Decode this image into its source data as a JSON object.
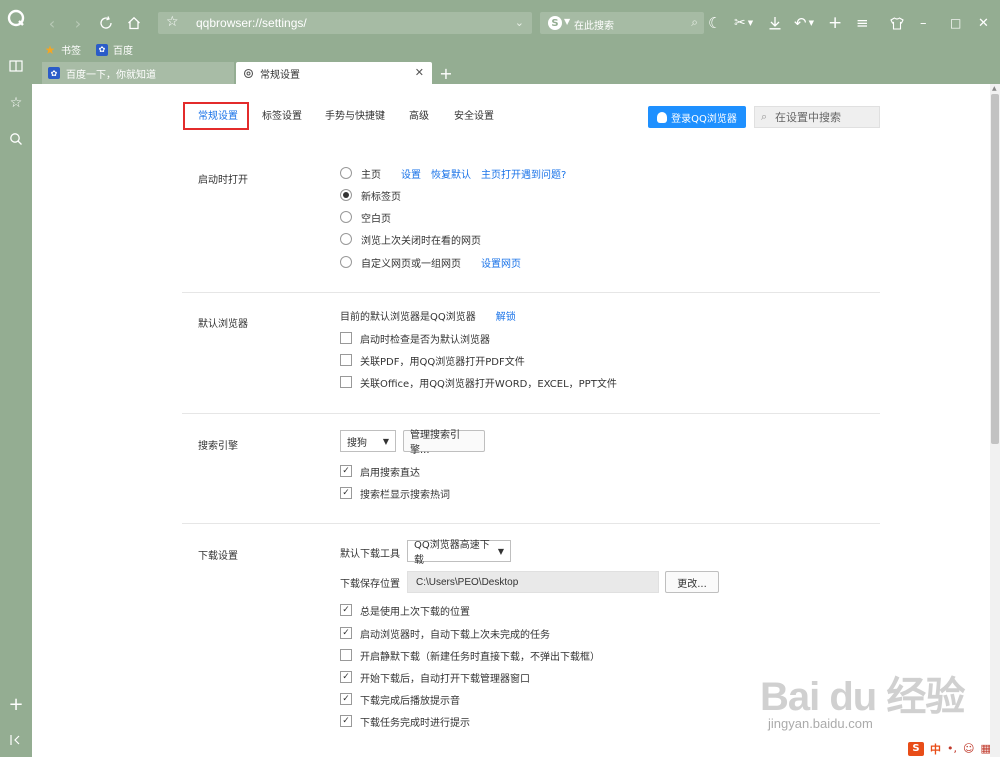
{
  "browser": {
    "address": "qqbrowser://settings/",
    "search_placeholder": "在此搜索",
    "search_engine_letter": "S"
  },
  "bookmarks": [
    {
      "label": "书签"
    },
    {
      "label": "百度"
    }
  ],
  "tabs": [
    {
      "title": "百度一下，你就知道",
      "active": false
    },
    {
      "title": "常规设置",
      "active": true
    }
  ],
  "settings": {
    "tabs": [
      {
        "label": "常规设置",
        "active": true
      },
      {
        "label": "标签设置",
        "active": false
      },
      {
        "label": "手势与快捷键",
        "active": false
      },
      {
        "label": "高级",
        "active": false
      },
      {
        "label": "安全设置",
        "active": false
      }
    ],
    "login_label": "登录QQ浏览器",
    "search_placeholder": "在设置中搜索",
    "startup": {
      "label": "启动时打开",
      "options": [
        {
          "label": "主页",
          "checked": false
        },
        {
          "label": "新标签页",
          "checked": true
        },
        {
          "label": "空白页",
          "checked": false
        },
        {
          "label": "浏览上次关闭时在看的网页",
          "checked": false
        },
        {
          "label": "自定义网页或一组网页",
          "checked": false
        }
      ],
      "home_links": [
        "设置",
        "恢复默认",
        "主页打开遇到问题?"
      ],
      "custom_link": "设置网页"
    },
    "default_browser": {
      "label": "默认浏览器",
      "status": "目前的默认浏览器是QQ浏览器",
      "unlock": "解锁",
      "options": [
        {
          "label": "启动时检查是否为默认浏览器",
          "checked": false
        },
        {
          "label": "关联PDF，用QQ浏览器打开PDF文件",
          "checked": false
        },
        {
          "label": "关联Office，用QQ浏览器打开WORD，EXCEL，PPT文件",
          "checked": false
        }
      ]
    },
    "search_engine": {
      "label": "搜索引擎",
      "selected": "搜狗",
      "manage": "管理搜索引擎...",
      "options": [
        {
          "label": "启用搜索直达",
          "checked": true
        },
        {
          "label": "搜索栏显示搜索热词",
          "checked": true
        }
      ]
    },
    "download": {
      "label": "下载设置",
      "tool_label": "默认下载工具",
      "tool_selected": "QQ浏览器高速下载",
      "path_label": "下载保存位置",
      "path": "C:\\Users\\PEO\\Desktop",
      "change": "更改...",
      "options": [
        {
          "label": "总是使用上次下载的位置",
          "checked": true
        },
        {
          "label": "启动浏览器时，自动下载上次未完成的任务",
          "checked": true
        },
        {
          "label": "开启静默下载（新建任务时直接下载，不弹出下载框）",
          "checked": false
        },
        {
          "label": "开始下载后，自动打开下载管理器窗口",
          "checked": true
        },
        {
          "label": "下载完成后播放提示音",
          "checked": true
        },
        {
          "label": "下载任务完成时进行提示",
          "checked": true
        }
      ]
    }
  },
  "watermark": {
    "brand": "Bai du 经验",
    "url": "jingyan.baidu.com"
  },
  "tray": {
    "s_label": "S",
    "zh": "中"
  },
  "colors": {
    "chrome": "#94ad92",
    "accent": "#1a73e8",
    "login": "#1e90ff",
    "highlight": "#e32b2b"
  }
}
